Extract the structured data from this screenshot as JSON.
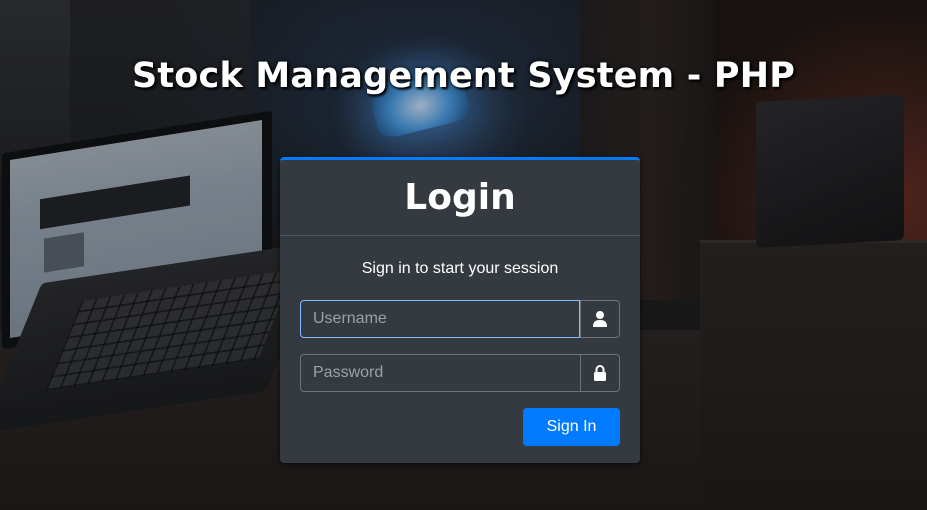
{
  "header": {
    "app_title": "Stock Management System - PHP"
  },
  "login": {
    "title": "Login",
    "message": "Sign in to start your session",
    "username": {
      "value": "",
      "placeholder": "Username",
      "icon": "user-icon"
    },
    "password": {
      "value": "",
      "placeholder": "Password",
      "icon": "lock-icon"
    },
    "submit_label": "Sign In"
  },
  "colors": {
    "accent": "#007bff",
    "card_bg": "#343a40",
    "focus_border": "#80bdff"
  }
}
